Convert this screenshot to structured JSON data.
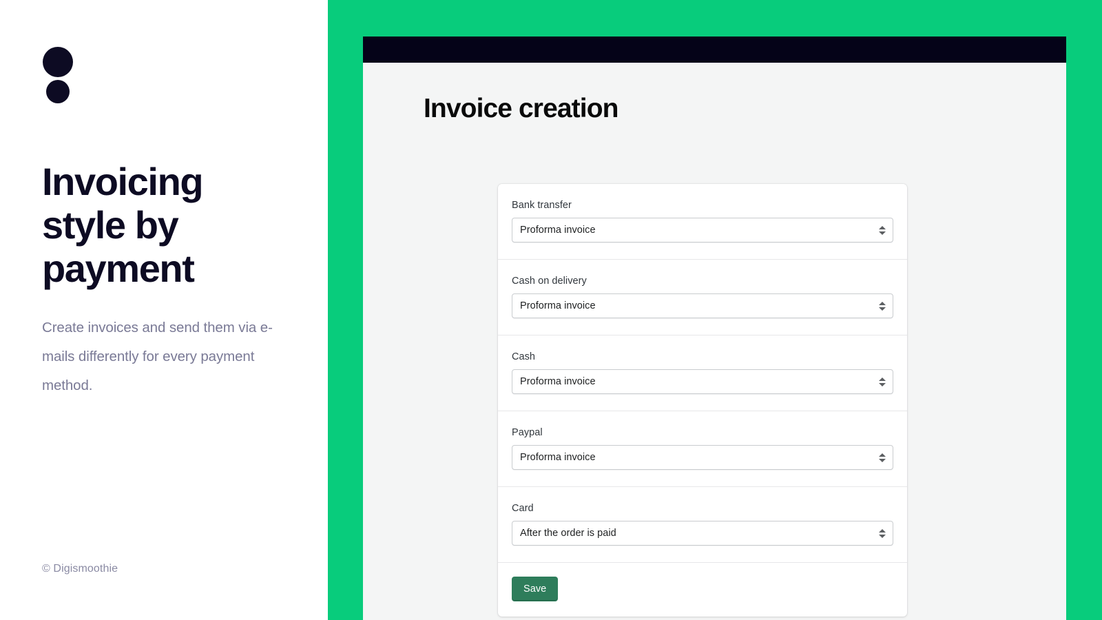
{
  "promo": {
    "logo_name": "digismoothie-dots-logo",
    "title": "Invoicing style by payment",
    "subtitle": "Create invoices and send them via e-mails differently for every payment method.",
    "footer": "© Digismoothie"
  },
  "colors": {
    "brand_green": "#08CC7C",
    "dark_navy": "#050318",
    "panel_bg": "#F4F5F5",
    "save_green": "#2E7D5B",
    "title_ink": "#0D0B23",
    "subtitle_gray": "#7A7A96"
  },
  "app": {
    "page_title": "Invoice creation",
    "form_rows": [
      {
        "label": "Bank transfer",
        "value": "Proforma invoice"
      },
      {
        "label": "Cash on delivery",
        "value": "Proforma invoice"
      },
      {
        "label": "Cash",
        "value": "Proforma invoice"
      },
      {
        "label": "Paypal",
        "value": "Proforma invoice"
      },
      {
        "label": "Card",
        "value": "After the order is paid"
      }
    ],
    "save_label": "Save"
  }
}
